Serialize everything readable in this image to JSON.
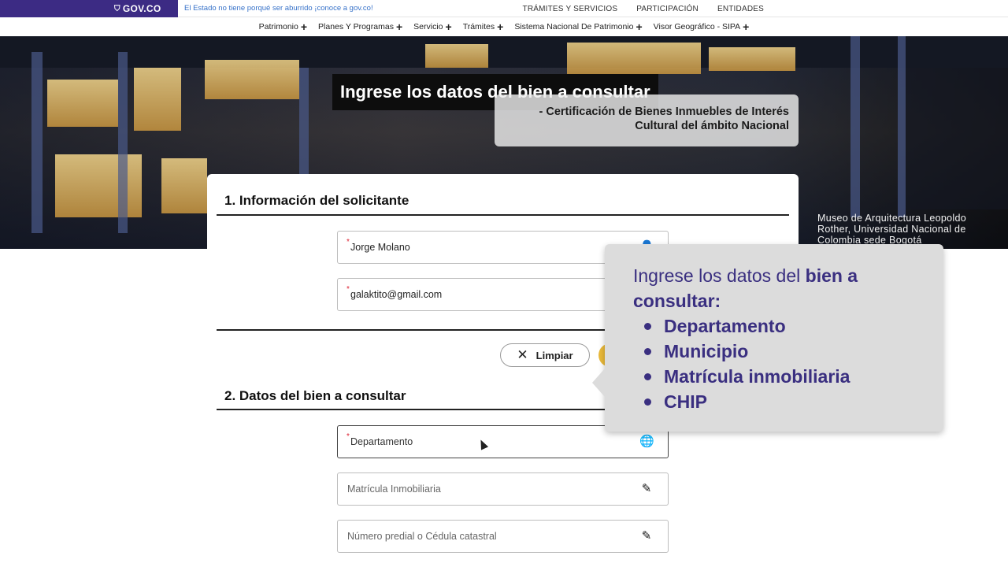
{
  "gov_bar": {
    "logo": "GOV.CO",
    "slogan": "El Estado no tiene porqué ser aburrido ¡conoce a gov.co!",
    "links": [
      "TRÁMITES Y SERVICIOS",
      "PARTICIPACIÓN",
      "ENTIDADES"
    ]
  },
  "nav": {
    "items": [
      "Patrimonio",
      "Planes Y Programas",
      "Servicio",
      "Trámites",
      "Sistema Nacional De Patrimonio",
      "Visor Geográfico - SIPA"
    ]
  },
  "hero": {
    "title": "Ingrese los datos del bien a consultar",
    "subtitle_line1": "- Certificación de Bienes Inmuebles de Interés",
    "subtitle_line2": "Cultural del ámbito Nacional",
    "credit": "Museo de Arquitectura Leopoldo Rother, Universidad Nacional de Colombia sede Bogotá"
  },
  "form": {
    "section1_title": "1. Información del solicitante",
    "name_value": "Jorge Molano",
    "email_value": "galaktito@gmail.com",
    "clear_label": "Limpiar",
    "section2_title": "2. Datos del bien a consultar",
    "departamento_placeholder": "Departamento",
    "matricula_placeholder": "Matrícula Inmobiliaria",
    "predial_placeholder": "Número predial o Cédula catastral",
    "required_mark": "*"
  },
  "callout": {
    "intro_plain": "Ingrese los datos del ",
    "intro_bold": "bien a consultar:",
    "items": [
      "Departamento",
      "Municipio",
      "Matrícula inmobiliaria",
      "CHIP"
    ]
  },
  "colors": {
    "gov_purple": "#3c2b84",
    "callout_text": "#3a2f80",
    "submit_yellow": "#e9b93a"
  }
}
